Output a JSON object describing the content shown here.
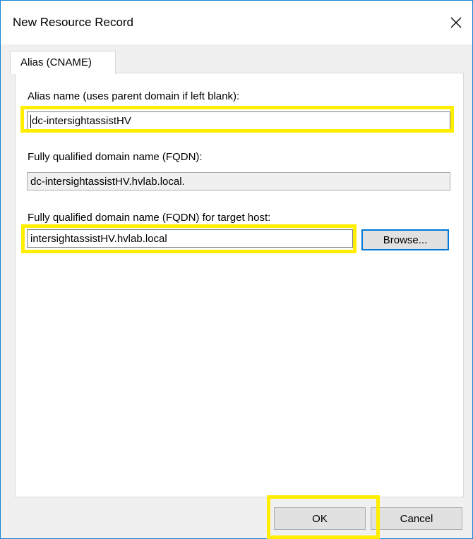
{
  "window": {
    "title": "New Resource Record"
  },
  "tabs": [
    {
      "label": "Alias (CNAME)"
    }
  ],
  "form": {
    "alias_label": "Alias name (uses parent domain if left blank):",
    "alias_value": "dc-intersightassistHV",
    "fqdn_label": "Fully qualified domain name (FQDN):",
    "fqdn_value": "dc-intersightassistHV.hvlab.local.",
    "target_label": "Fully qualified domain name (FQDN) for target host:",
    "target_value": "intersightassistHV.hvlab.local",
    "browse_label": "Browse..."
  },
  "footer": {
    "ok_label": "OK",
    "cancel_label": "Cancel"
  },
  "colors": {
    "highlight": "#ffee00",
    "window_border": "#1883d7",
    "focus_border": "#0078d7"
  },
  "icons": {
    "close": "close-icon"
  }
}
